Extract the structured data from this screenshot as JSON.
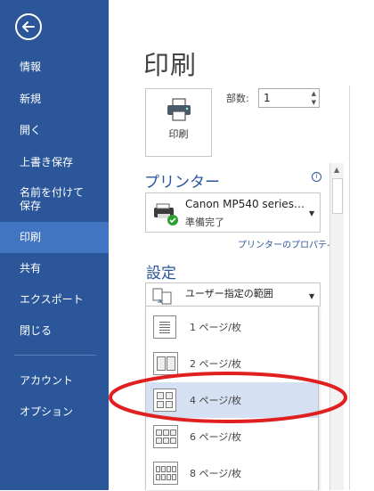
{
  "sidebar": {
    "items": [
      {
        "label": "情報"
      },
      {
        "label": "新規"
      },
      {
        "label": "開く"
      },
      {
        "label": "上書き保存"
      },
      {
        "label": "名前を付けて\n保存"
      },
      {
        "label": "印刷"
      },
      {
        "label": "共有"
      },
      {
        "label": "エクスポート"
      },
      {
        "label": "閉じる"
      },
      {
        "label": "アカウント"
      },
      {
        "label": "オプション"
      }
    ],
    "active_index": 5,
    "bg_color": "#2b579a",
    "active_color": "#4175c1"
  },
  "main": {
    "title": "印刷",
    "print_button_label": "印刷",
    "copies_label": "部数:",
    "copies_value": "1",
    "printer_section": "プリンター",
    "printer_name": "Canon MP540 series…",
    "printer_status": "準備完了",
    "printer_properties_link": "プリンターのプロパティ",
    "settings_section": "設定",
    "setting_value": "ユーザー指定の範囲",
    "accent_color": "#2b579a"
  },
  "dropdown": {
    "options": [
      {
        "label": "1 ページ/枚"
      },
      {
        "label": "2 ページ/枚"
      },
      {
        "label": "4 ページ/枚"
      },
      {
        "label": "6 ページ/枚"
      },
      {
        "label": "8 ページ/枚"
      }
    ],
    "selected_index": 2,
    "highlight_color": "#d5e1f2",
    "annotation_color": "#e02020"
  }
}
